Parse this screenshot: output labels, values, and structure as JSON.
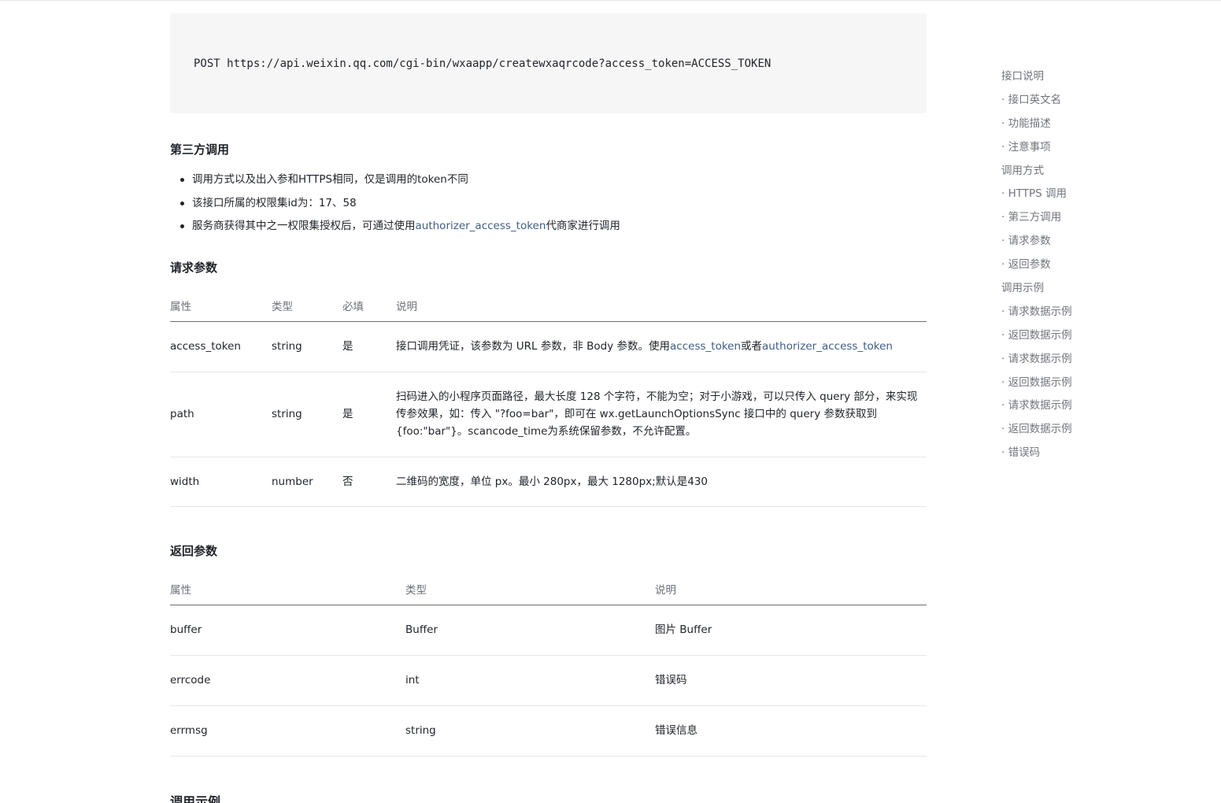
{
  "code": {
    "url": "POST https://api.weixin.qq.com/cgi-bin/wxaapp/createwxaqrcode?access_token=ACCESS_TOKEN"
  },
  "third_party": {
    "title": "第三方调用",
    "bullets": [
      {
        "text": "调用方式以及出入参和HTTPS相同，仅是调用的token不同"
      },
      {
        "text": "该接口所属的权限集id为：17、58"
      },
      {
        "text_before": "服务商获得其中之一权限集授权后，可通过使用",
        "link": "authorizer_access_token",
        "text_after": "代商家进行调用"
      }
    ]
  },
  "request_params": {
    "title": "请求参数",
    "headers": [
      "属性",
      "类型",
      "必填",
      "说明"
    ],
    "rows": [
      {
        "name": "access_token",
        "type": "string",
        "required": "是",
        "desc_before": "接口调用凭证，该参数为 URL 参数，非 Body 参数。使用",
        "desc_link1": "access_token",
        "desc_mid": "或者",
        "desc_link2": "authorizer_access_token"
      },
      {
        "name": "path",
        "type": "string",
        "required": "是",
        "desc": "扫码进入的小程序页面路径，最大长度 128 个字符，不能为空；对于小游戏，可以只传入 query 部分，来实现传参效果，如：传入 \"?foo=bar\"，即可在 wx.getLaunchOptionsSync 接口中的 query 参数获取到 {foo:\"bar\"}。scancode_time为系统保留参数，不允许配置。"
      },
      {
        "name": "width",
        "type": "number",
        "required": "否",
        "desc": "二维码的宽度，单位 px。最小 280px，最大 1280px;默认是430"
      }
    ]
  },
  "return_params": {
    "title": "返回参数",
    "headers": [
      "属性",
      "类型",
      "说明"
    ],
    "rows": [
      {
        "name": "buffer",
        "type": "Buffer",
        "desc": "图片 Buffer"
      },
      {
        "name": "errcode",
        "type": "int",
        "desc": "错误码"
      },
      {
        "name": "errmsg",
        "type": "string",
        "desc": "错误信息"
      }
    ]
  },
  "example": {
    "title": "调用示例"
  },
  "toc": [
    {
      "label": "接口说明"
    },
    {
      "label": "接口英文名"
    },
    {
      "label": "功能描述"
    },
    {
      "label": "注意事项"
    },
    {
      "label": "调用方式"
    },
    {
      "label": "HTTPS 调用"
    },
    {
      "label": "第三方调用"
    },
    {
      "label": "请求参数"
    },
    {
      "label": "返回参数"
    },
    {
      "label": "调用示例"
    },
    {
      "label": "请求数据示例"
    },
    {
      "label": "返回数据示例"
    },
    {
      "label": "请求数据示例"
    },
    {
      "label": "返回数据示例"
    },
    {
      "label": "请求数据示例"
    },
    {
      "label": "返回数据示例"
    },
    {
      "label": "错误码"
    }
  ]
}
